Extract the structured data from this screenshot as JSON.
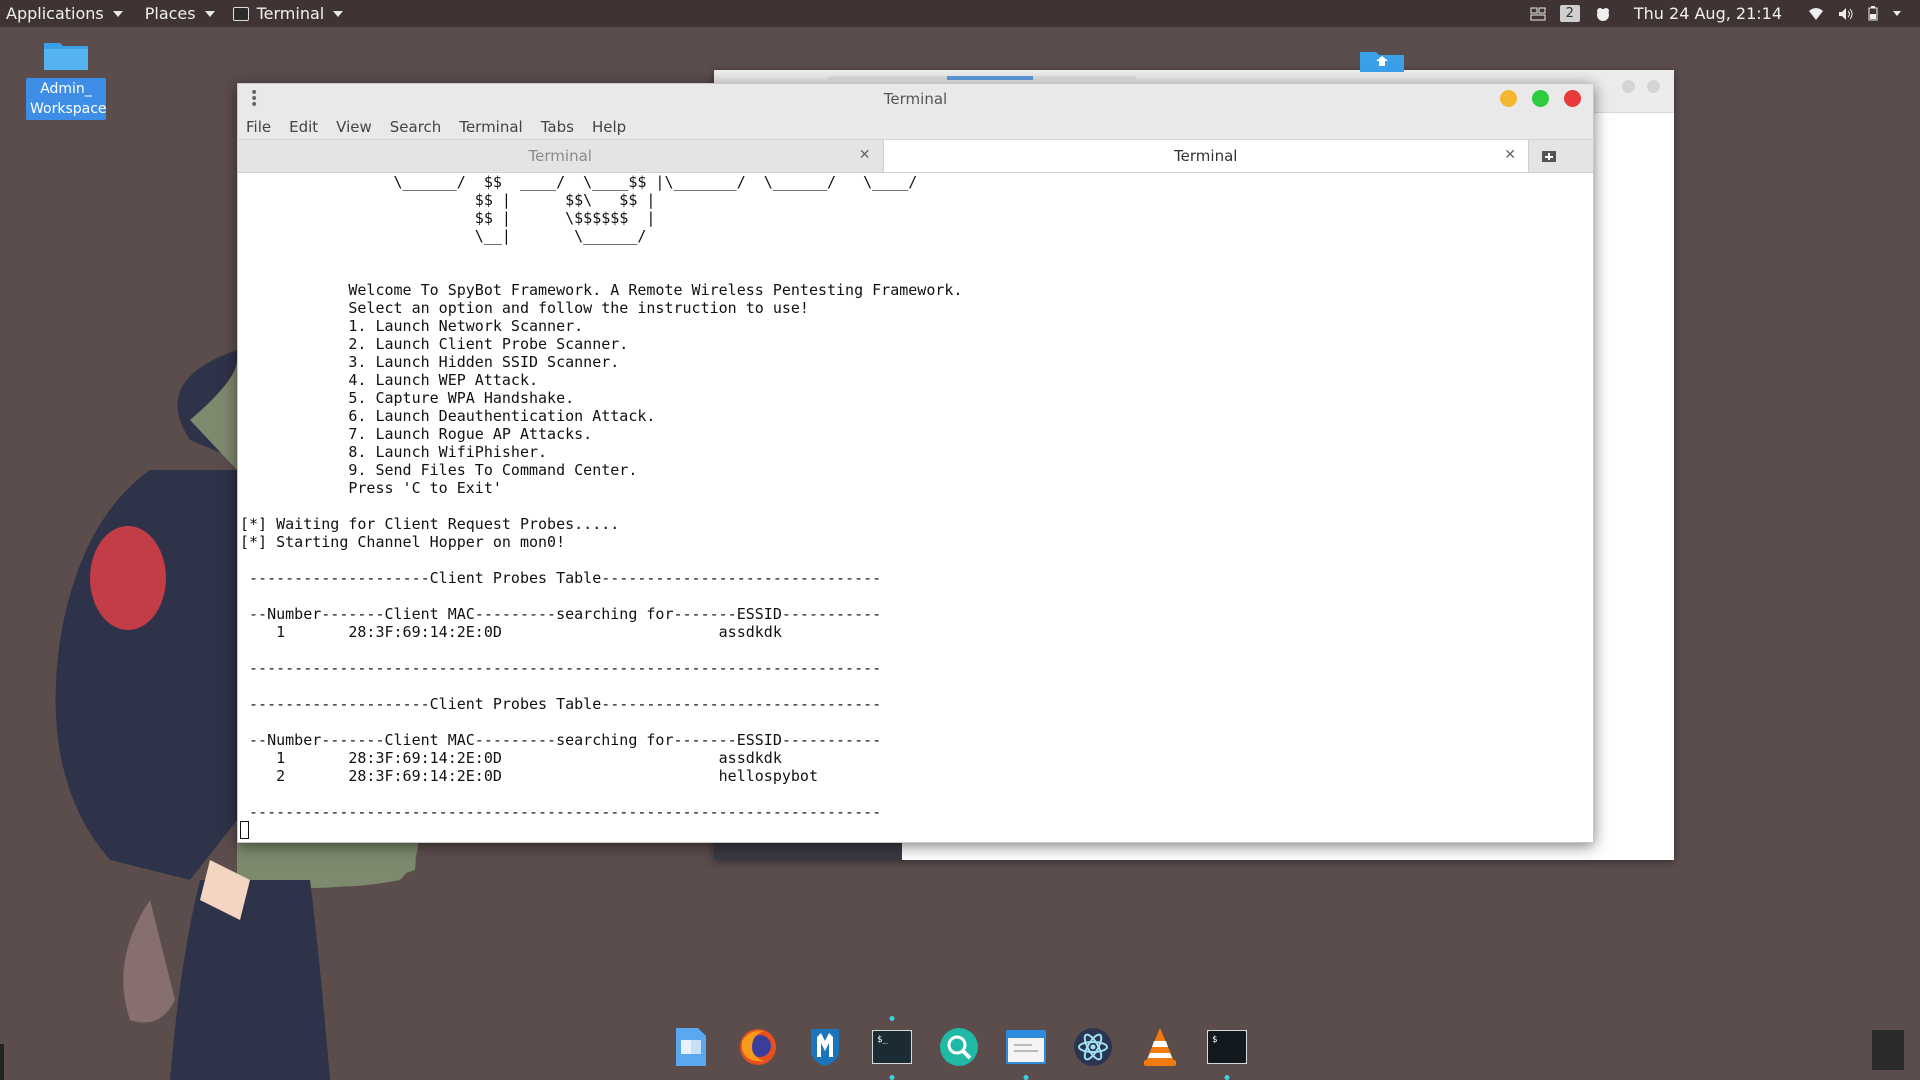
{
  "topbar": {
    "applications": "Applications",
    "places": "Places",
    "active_app": "Terminal",
    "workspace_number": "2",
    "datetime": "Thu 24 Aug, 21:14"
  },
  "desktop": {
    "icon_label": "Admin_ Workspace"
  },
  "terminal": {
    "title": "Terminal",
    "menu": [
      "File",
      "Edit",
      "View",
      "Search",
      "Terminal",
      "Tabs",
      "Help"
    ],
    "tabs": [
      {
        "label": "Terminal",
        "active": false
      },
      {
        "label": "Terminal",
        "active": true
      }
    ],
    "content": "                 \\______/  $$  ____/  \\____$$ |\\_______/  \\______/   \\____/\n                          $$ |      $$\\   $$ |\n                          $$ |      \\$$$$$$  |\n                          \\__|       \\______/\n\n\n            Welcome To SpyBot Framework. A Remote Wireless Pentesting Framework.\n            Select an option and follow the instruction to use!\n            1. Launch Network Scanner.\n            2. Launch Client Probe Scanner.\n            3. Launch Hidden SSID Scanner.\n            4. Launch WEP Attack.\n            5. Capture WPA Handshake.\n            6. Launch Deauthentication Attack.\n            7. Launch Rogue AP Attacks.\n            8. Launch WifiPhisher.\n            9. Send Files To Command Center.\n            Press 'C to Exit'\n\n[*] Waiting for Client Request Probes.....\n[*] Starting Channel Hopper on mon0!\n\n --------------------Client Probes Table-------------------------------\n\n --Number-------Client MAC---------searching for-------ESSID-----------\n    1       28:3F:69:14:2E:0D                        assdkdk\n\n ----------------------------------------------------------------------\n\n --------------------Client Probes Table-------------------------------\n\n --Number-------Client MAC---------searching for-------ESSID-----------\n    1       28:3F:69:14:2E:0D                        assdkdk\n    2       28:3F:69:14:2E:0D                        hellospybot\n\n ----------------------------------------------------------------------"
  },
  "colors": {
    "desktop_bg": "#5c4d4d",
    "topbar_bg": "#3f3333",
    "minimize": "#f5b731",
    "maximize": "#2ecc40",
    "close": "#e8393b",
    "selection": "#3e8ee8"
  },
  "dock": [
    "files-icon",
    "firefox-icon",
    "metasploit-icon",
    "terminal-icon",
    "search-icon",
    "mail-icon",
    "atom-icon",
    "vlc-icon",
    "terminal-icon"
  ]
}
